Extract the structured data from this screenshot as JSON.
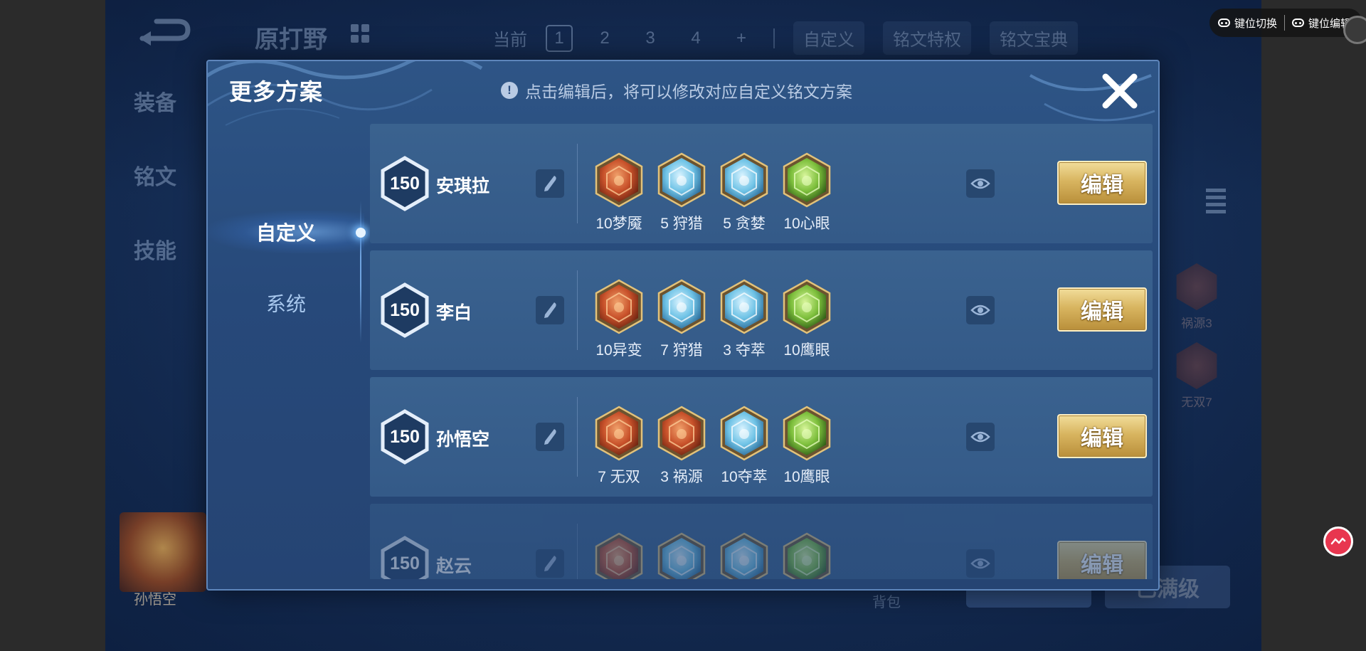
{
  "background": {
    "title": "原打野",
    "tabs": {
      "current_label": "当前",
      "pages": [
        "1",
        "2",
        "3",
        "4",
        "+"
      ],
      "custom": "自定义",
      "privilege": "铭文特权",
      "treasure": "铭文宝典"
    },
    "left_menu": [
      "装备",
      "铭文",
      "技能"
    ],
    "right_runes": [
      "祸源3",
      "无双7"
    ],
    "avatar_name": "孙悟空",
    "bottom_bag": "背包",
    "bottom_max": "已满级"
  },
  "dialog": {
    "title": "更多方案",
    "hint": "点击编辑后，将可以修改对应自定义铭文方案",
    "info_glyph": "!",
    "sidebar": {
      "active": "自定义",
      "inactive": "系统"
    },
    "edit_label": "编辑",
    "plans": [
      {
        "level": "150",
        "hero": "安琪拉",
        "runes": [
          {
            "label": "10梦魇",
            "color": "red",
            "icon": "nightmare-rune"
          },
          {
            "label": "5 狩猎",
            "color": "blue",
            "icon": "hunt-rune"
          },
          {
            "label": "5 贪婪",
            "color": "blue",
            "icon": "greed-rune"
          },
          {
            "label": "10心眼",
            "color": "green",
            "icon": "mind-eye-rune"
          }
        ]
      },
      {
        "level": "150",
        "hero": "李白",
        "runes": [
          {
            "label": "10异变",
            "color": "red",
            "icon": "mutation-rune"
          },
          {
            "label": "7 狩猎",
            "color": "blue",
            "icon": "hunt-rune"
          },
          {
            "label": "3 夺萃",
            "color": "blue",
            "icon": "plunder-rune"
          },
          {
            "label": "10鹰眼",
            "color": "green",
            "icon": "hawk-eye-rune"
          }
        ]
      },
      {
        "level": "150",
        "hero": "孙悟空",
        "runes": [
          {
            "label": "7 无双",
            "color": "red",
            "icon": "peerless-rune"
          },
          {
            "label": "3 祸源",
            "color": "red",
            "icon": "calamity-rune"
          },
          {
            "label": "10夺萃",
            "color": "blue",
            "icon": "plunder-rune"
          },
          {
            "label": "10鹰眼",
            "color": "green",
            "icon": "hawk-eye-rune"
          }
        ]
      },
      {
        "level": "150",
        "hero": "赵云",
        "runes": [
          {
            "label": "",
            "color": "red",
            "icon": "red-rune"
          },
          {
            "label": "",
            "color": "blue",
            "icon": "blue-rune"
          },
          {
            "label": "",
            "color": "blue",
            "icon": "blue-rune"
          },
          {
            "label": "",
            "color": "green",
            "icon": "green-rune"
          }
        ]
      }
    ]
  },
  "overlay": {
    "switch_label": "键位切换",
    "edit_label": "键位编辑"
  },
  "colors": {
    "rune_red": "#c8512a",
    "rune_blue": "#6fc3e6",
    "rune_green": "#7dbf3c",
    "edit_gold": "#d8b560",
    "float_btn": "#e8364f"
  }
}
